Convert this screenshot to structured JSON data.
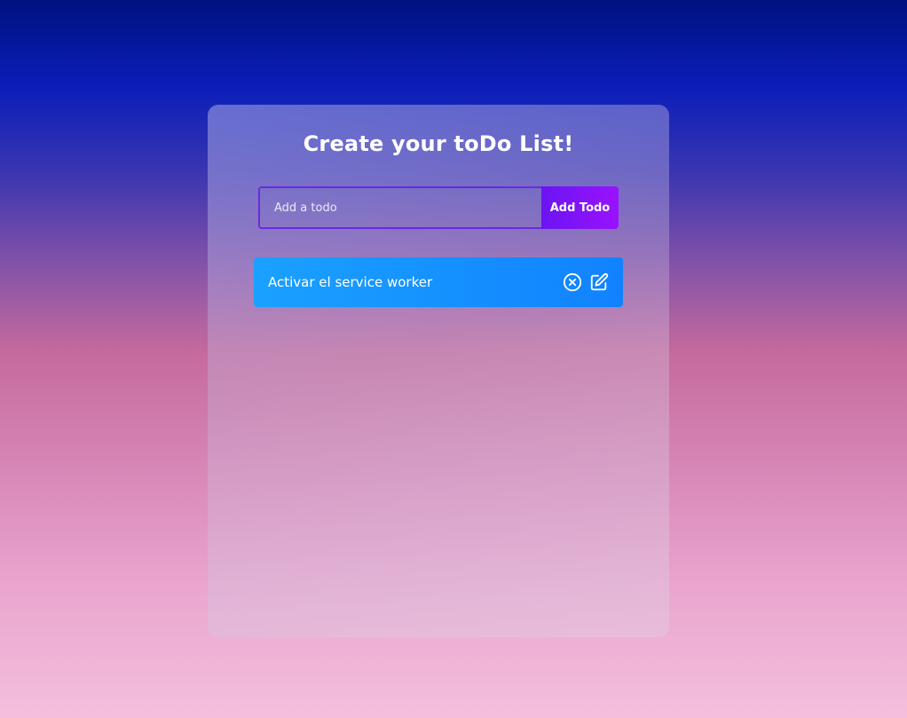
{
  "app": {
    "title": "Create your toDo List!"
  },
  "form": {
    "input_placeholder": "Add a todo",
    "input_value": "",
    "add_button_label": "Add Todo"
  },
  "todos": [
    {
      "text": "Activar el service worker",
      "delete_icon": "close-circle-icon",
      "edit_icon": "edit-icon"
    }
  ],
  "colors": {
    "button_accent": "#8a14ff",
    "todo_item": "#1590ff",
    "input_border": "#6a2ae0",
    "text": "#ffffff"
  }
}
